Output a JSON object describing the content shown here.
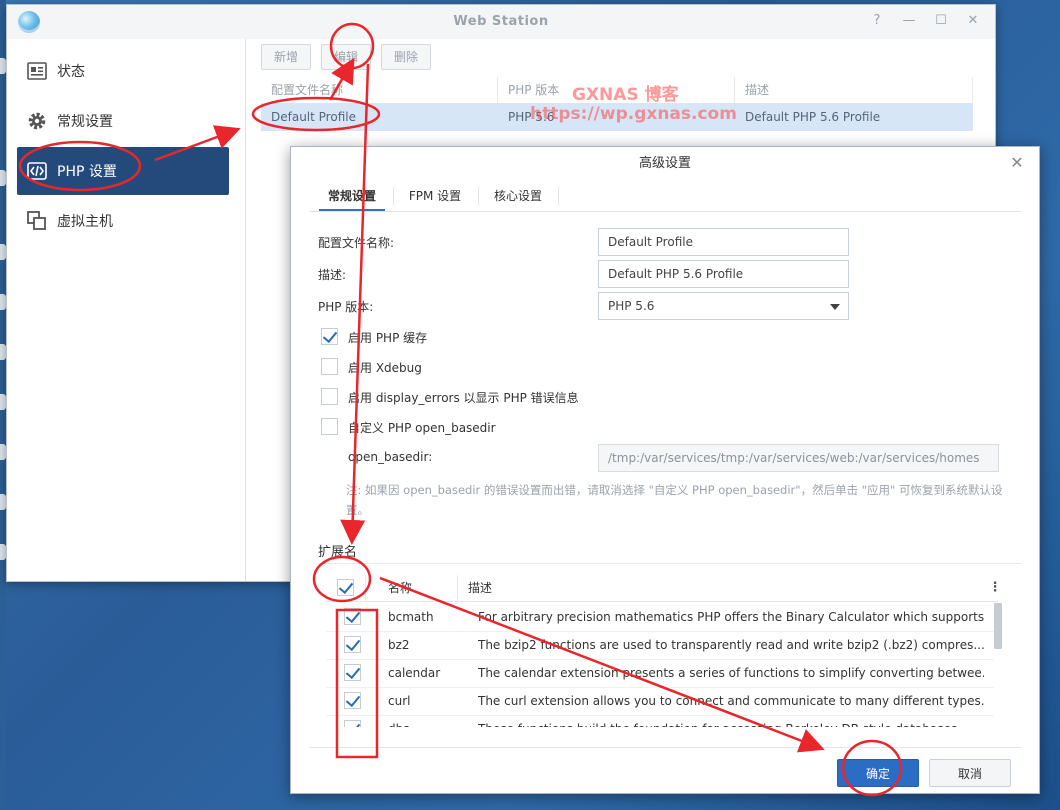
{
  "window": {
    "title": "Web Station"
  },
  "sidebar": {
    "items": [
      {
        "label": "状态",
        "icon": "status-icon"
      },
      {
        "label": "常规设置",
        "icon": "gear-icon"
      },
      {
        "label": "PHP 设置",
        "icon": "code-icon"
      },
      {
        "label": "虚拟主机",
        "icon": "virtual-host-icon"
      }
    ]
  },
  "toolbar": {
    "add_label": "新增",
    "edit_label": "编辑",
    "delete_label": "删除"
  },
  "profiles_table": {
    "headers": [
      "配置文件名称",
      "PHP 版本",
      "描述"
    ],
    "rows": [
      {
        "name": "Default Profile",
        "php": "PHP 5.6",
        "desc": "Default PHP 5.6 Profile"
      }
    ]
  },
  "watermark": {
    "line1": "GXNAS 博客",
    "line2": "https://wp.gxnas.com"
  },
  "dialog": {
    "title": "高级设置",
    "tabs": [
      "常规设置",
      "FPM 设置",
      "核心设置"
    ],
    "fields": {
      "profile_name_label": "配置文件名称:",
      "profile_name_value": "Default Profile",
      "desc_label": "描述:",
      "desc_value": "Default PHP 5.6 Profile",
      "php_version_label": "PHP 版本:",
      "php_version_value": "PHP 5.6"
    },
    "options": [
      {
        "label": "启用 PHP 缓存",
        "checked": true
      },
      {
        "label": "启用 Xdebug",
        "checked": false
      },
      {
        "label": "启用 display_errors 以显示 PHP 错误信息",
        "checked": false
      },
      {
        "label": "自定义 PHP open_basedir",
        "checked": false
      }
    ],
    "open_basedir_label": "open_basedir:",
    "open_basedir_value": "/tmp:/var/services/tmp:/var/services/web:/var/services/homes",
    "note": "注: 如果因 open_basedir 的错误设置而出错，请取消选择 \"自定义 PHP open_basedir\"，然后单击 \"应用\" 可恢复到系统默认设置。",
    "extensions_title": "扩展名",
    "ext_headers": [
      "名称",
      "描述"
    ],
    "extensions": [
      {
        "name": "bcmath",
        "desc": "For arbitrary precision mathematics PHP offers the Binary Calculator which supports...",
        "checked": true
      },
      {
        "name": "bz2",
        "desc": "The bzip2 functions are used to transparently read and write bzip2 (.bz2) compres...",
        "checked": true
      },
      {
        "name": "calendar",
        "desc": "The calendar extension presents a series of functions to simplify converting betwee...",
        "checked": true
      },
      {
        "name": "curl",
        "desc": "The curl extension allows you to connect and communicate to many different types...",
        "checked": true
      },
      {
        "name": "dba",
        "desc": "These functions build the foundation for accessing Berkeley DB style databases...",
        "checked": true
      }
    ],
    "ok_label": "确定",
    "cancel_label": "取消"
  },
  "colors": {
    "accent": "#2b6cc4",
    "sidebar_active": "#244a7c",
    "annotation": "#e8262b"
  }
}
